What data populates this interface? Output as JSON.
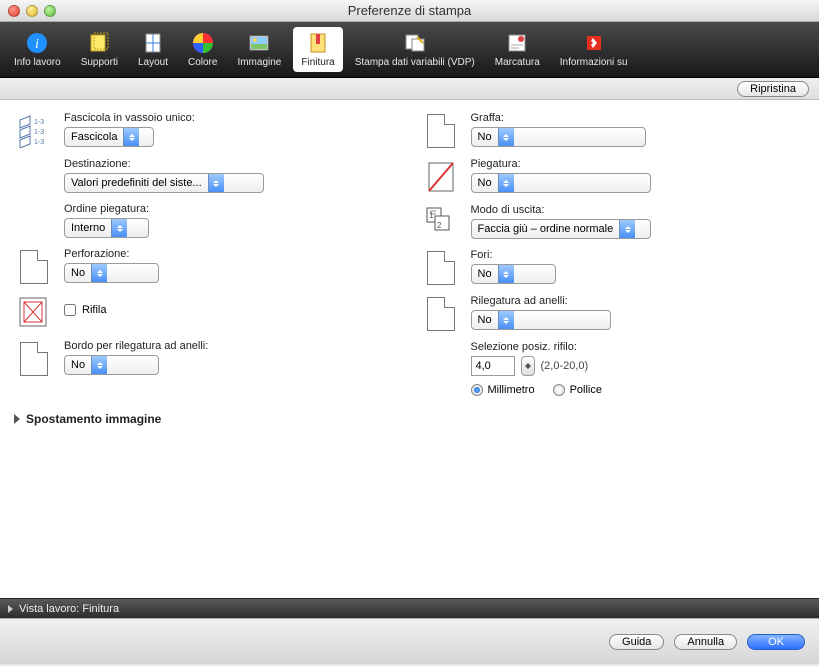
{
  "window": {
    "title": "Preferenze di stampa"
  },
  "toolbar": {
    "items": [
      {
        "id": "info",
        "label": "Info lavoro"
      },
      {
        "id": "supporti",
        "label": "Supporti"
      },
      {
        "id": "layout",
        "label": "Layout"
      },
      {
        "id": "colore",
        "label": "Colore"
      },
      {
        "id": "immagine",
        "label": "Immagine"
      },
      {
        "id": "finitura",
        "label": "Finitura"
      },
      {
        "id": "vdp",
        "label": "Stampa dati variabili (VDP)"
      },
      {
        "id": "marcatura",
        "label": "Marcatura"
      },
      {
        "id": "infosu",
        "label": "Informazioni su"
      }
    ],
    "selected": "finitura"
  },
  "topbar": {
    "reset": "Ripristina"
  },
  "left": {
    "fascicola": {
      "label": "Fascicola in vassoio unico:",
      "value": "Fascicola"
    },
    "destinazione": {
      "label": "Destinazione:",
      "value": "Valori predefiniti del siste..."
    },
    "ordine": {
      "label": "Ordine piegatura:",
      "value": "Interno"
    },
    "perforazione": {
      "label": "Perforazione:",
      "value": "No"
    },
    "rifila": {
      "label": "Rifila"
    },
    "bordo": {
      "label": "Bordo per rilegatura ad anelli:",
      "value": "No"
    }
  },
  "right": {
    "graffa": {
      "label": "Graffa:",
      "value": "No"
    },
    "piegatura": {
      "label": "Piegatura:",
      "value": "No"
    },
    "uscita": {
      "label": "Modo di uscita:",
      "value": "Faccia giù – ordine normale"
    },
    "fori": {
      "label": "Fori:",
      "value": "No"
    },
    "rilegatura": {
      "label": "Rilegatura ad anelli:",
      "value": "No"
    },
    "rifilo": {
      "label": "Selezione posiz. rifilo:",
      "value": "4,0",
      "range": "(2,0-20,0)"
    },
    "units": {
      "mm": "Millimetro",
      "in": "Pollice",
      "selected": "mm"
    }
  },
  "sections": {
    "spostamento": "Spostamento immagine",
    "vista": "Vista lavoro: Finitura"
  },
  "footer": {
    "help": "Guida",
    "cancel": "Annulla",
    "ok": "OK"
  }
}
